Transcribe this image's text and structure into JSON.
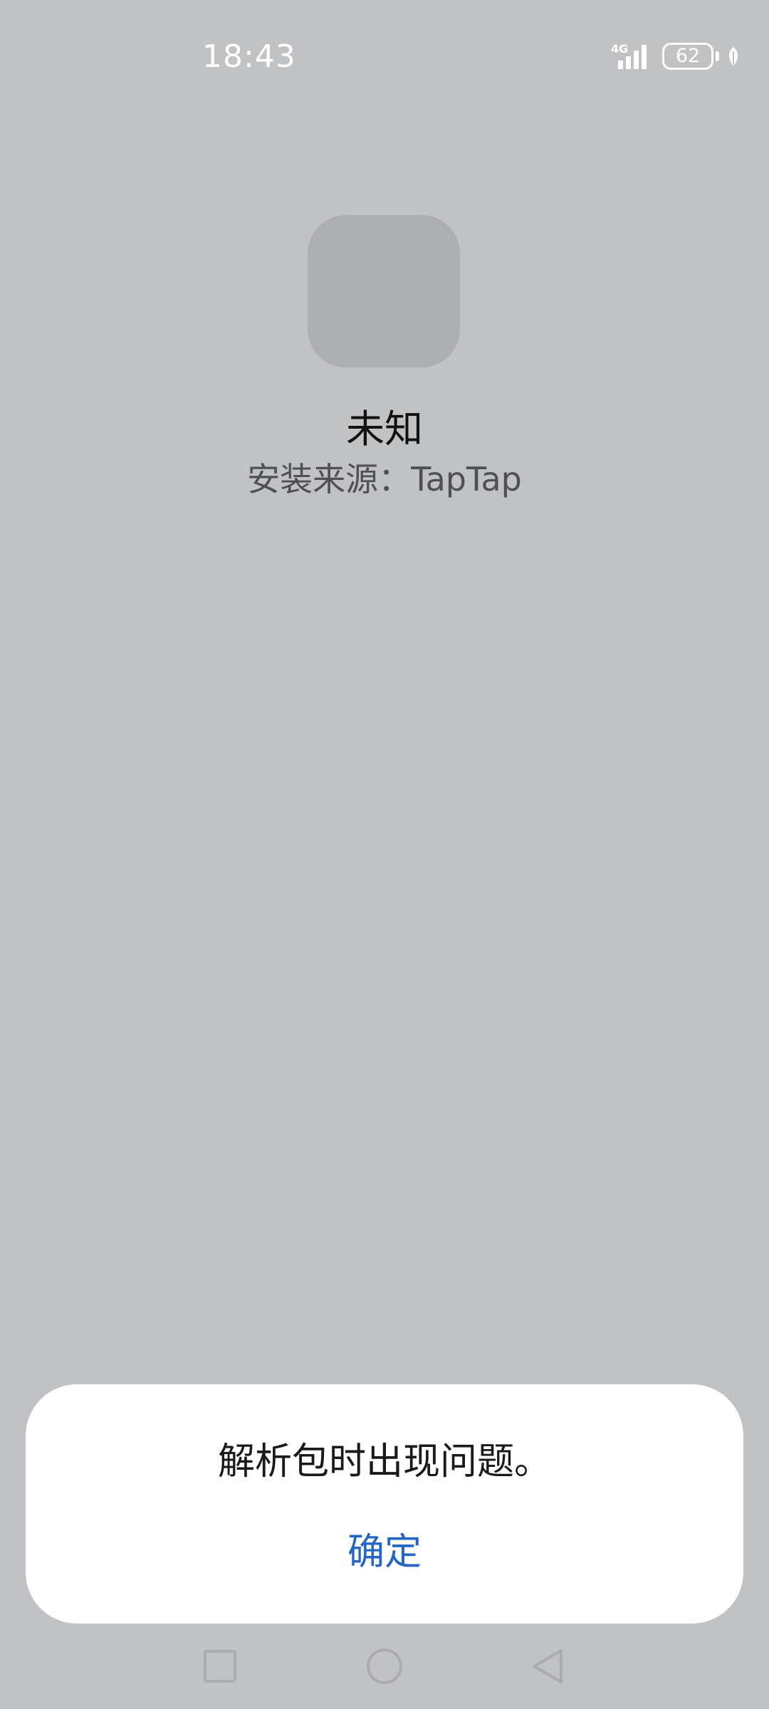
{
  "status_bar": {
    "time": "18:43",
    "network_type": "4G",
    "battery_level": "62",
    "icons": [
      "signal-icon",
      "battery-icon",
      "leaf-icon"
    ]
  },
  "app": {
    "icon": "app-placeholder-icon",
    "name": "未知",
    "install_source": "安装来源：TapTap"
  },
  "dialog": {
    "message": "解析包时出现问题。",
    "confirm_label": "确定",
    "confirm_color": "#2466c8"
  },
  "nav_bar": {
    "icons": [
      "recents-square-icon",
      "home-circle-icon",
      "back-triangle-icon"
    ]
  },
  "colors": {
    "background": "#c1c2c4",
    "dialog_background": "#ffffff"
  }
}
